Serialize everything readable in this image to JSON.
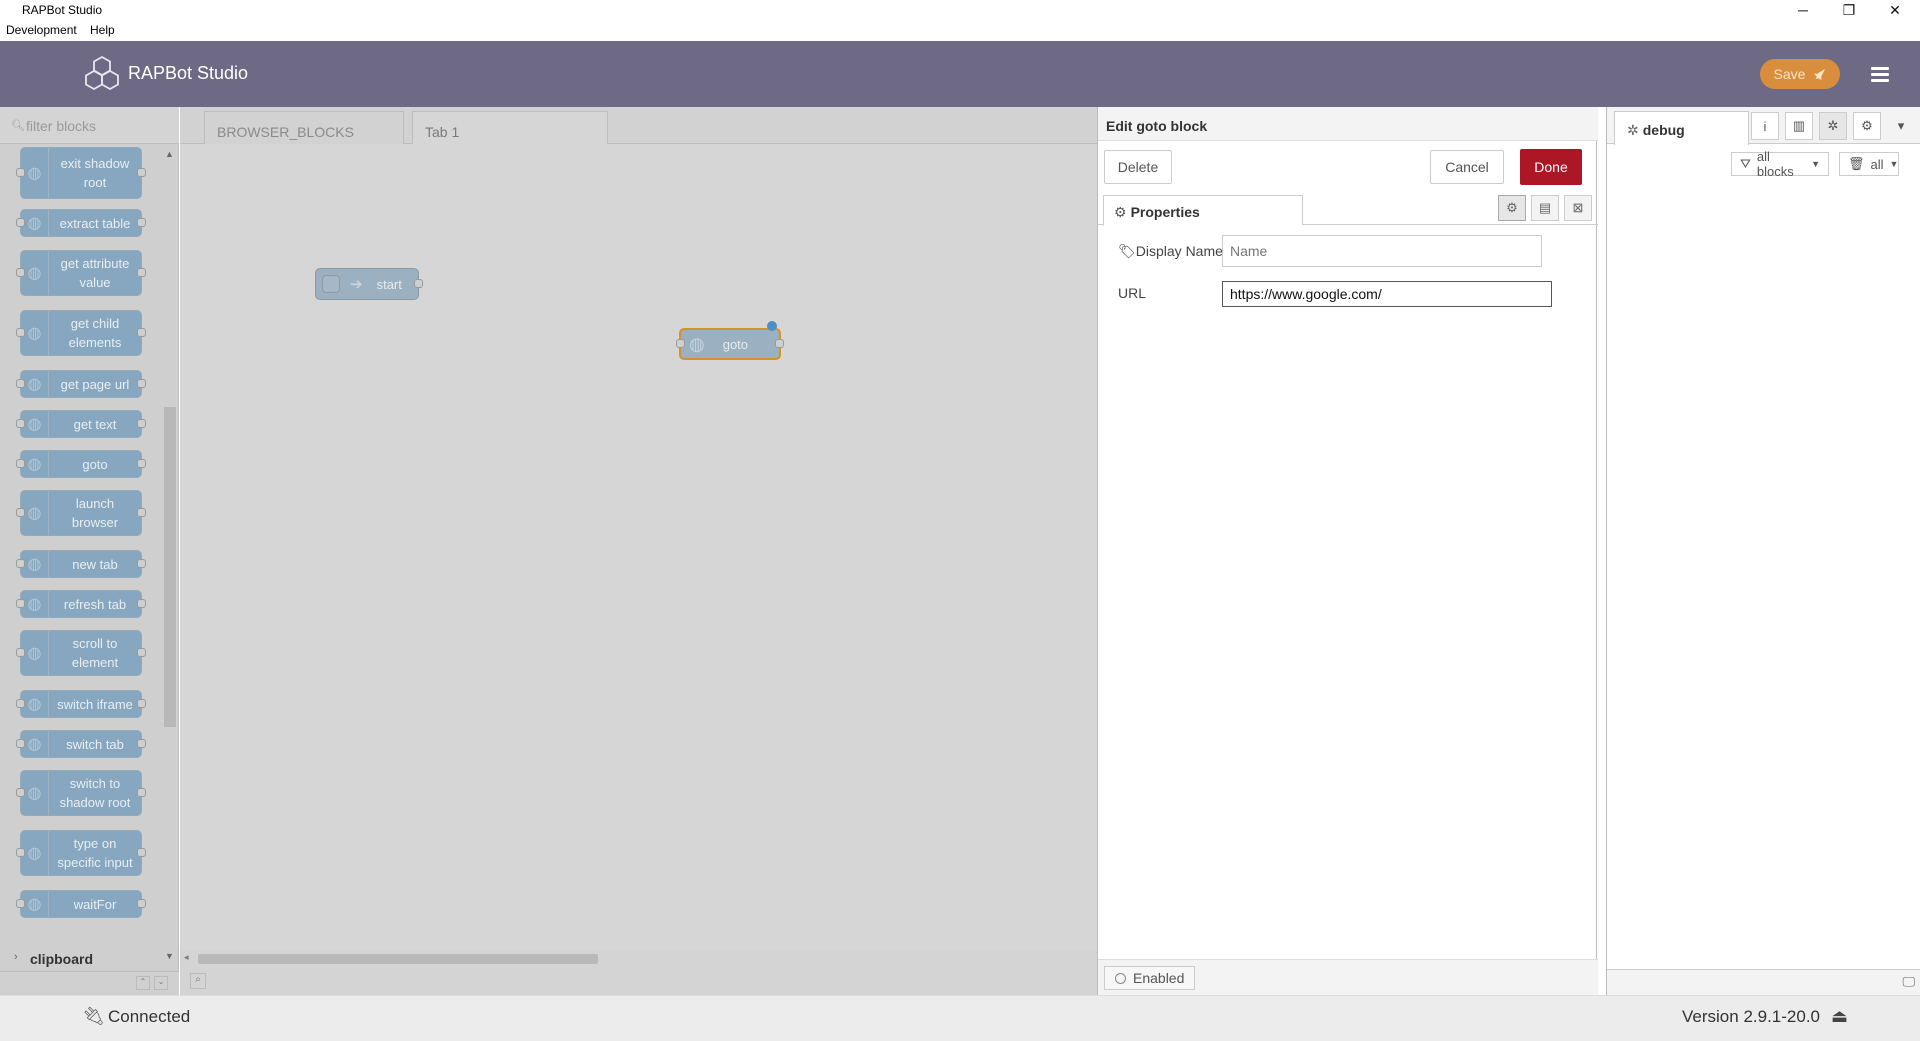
{
  "window": {
    "title": "RAPBot Studio",
    "controls": {
      "minimize": "─",
      "maximize": "❐",
      "close": "✕"
    }
  },
  "menubar": {
    "items": [
      "Development",
      "Help"
    ]
  },
  "header": {
    "app_name": "RAPBot Studio",
    "save_label": "Save",
    "accent": "#d98e3e",
    "bg": "#6e6a86"
  },
  "palette": {
    "filter_placeholder": "filter blocks",
    "blocks": [
      {
        "label": "exit shadow root"
      },
      {
        "label": "extract table"
      },
      {
        "label": "get attribute value"
      },
      {
        "label": "get child elements"
      },
      {
        "label": "get page url"
      },
      {
        "label": "get text"
      },
      {
        "label": "goto"
      },
      {
        "label": "launch browser"
      },
      {
        "label": "new tab"
      },
      {
        "label": "refresh tab"
      },
      {
        "label": "scroll to element"
      },
      {
        "label": "switch iframe"
      },
      {
        "label": "switch tab"
      },
      {
        "label": "switch to shadow root"
      },
      {
        "label": "type on specific input"
      },
      {
        "label": "waitFor"
      }
    ],
    "category": "clipboard"
  },
  "workspace": {
    "tabs": [
      "BROWSER_BLOCKS",
      "Tab 1"
    ],
    "nodes": {
      "start": "start",
      "goto": "goto"
    }
  },
  "edit_tray": {
    "title": "Edit goto block",
    "delete_label": "Delete",
    "cancel_label": "Cancel",
    "done_label": "Done",
    "properties_tab": "Properties",
    "display_name_label": "Display Name",
    "display_name_placeholder": "Name",
    "display_name_value": "",
    "url_label": "URL",
    "url_value": "https://www.google.com/",
    "enabled_label": "Enabled"
  },
  "sidebar": {
    "active_tab": "debug",
    "filter_blocks": "all blocks",
    "filter_clear": "all"
  },
  "statusbar": {
    "connection": "Connected",
    "version": "Version 2.9.1-20.0"
  }
}
